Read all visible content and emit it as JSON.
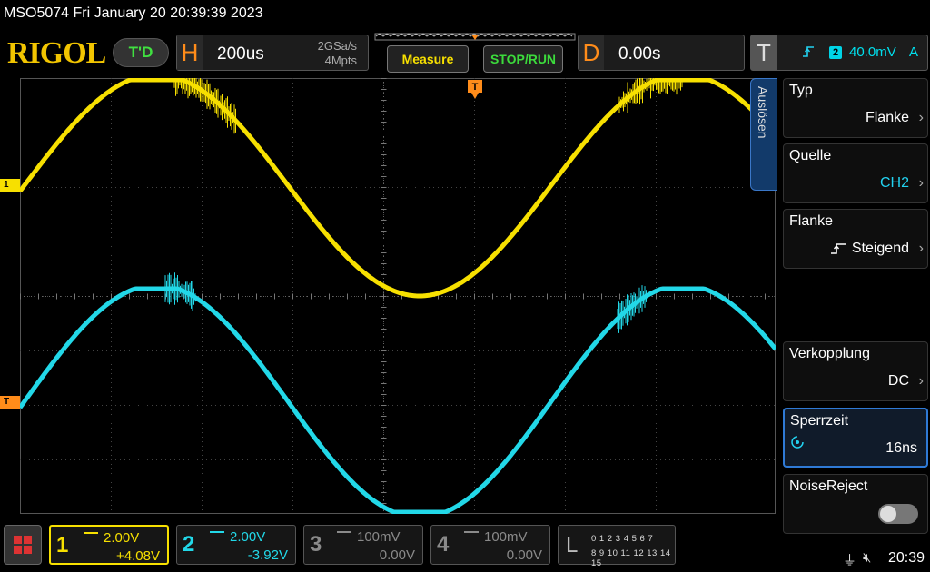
{
  "titlebar": {
    "text": "MSO5074  Fri January 20 20:39:39 2023"
  },
  "header": {
    "logo": "RIGOL",
    "td_label": "T'D",
    "horizontal": {
      "letter": "H",
      "timebase": "200us",
      "sample_rate": "2GSa/s",
      "memory_depth": "4Mpts"
    },
    "measure_label": "Measure",
    "stoprun_label": "STOP/RUN",
    "delay": {
      "letter": "D",
      "value": "0.00s"
    },
    "trigger": {
      "letter": "T",
      "source": "2",
      "level": "40.0mV",
      "mode": "A"
    }
  },
  "markers": {
    "ch1": "1",
    "ch2": "T",
    "trigger_top": "T"
  },
  "side_menu": {
    "tab_label": "Auslösen",
    "items": [
      {
        "title": "Typ",
        "value": "Flanke"
      },
      {
        "title": "Quelle",
        "value": "CH2"
      },
      {
        "title": "Flanke",
        "value": "Steigend"
      },
      {
        "title": "Verkopplung",
        "value": "DC"
      },
      {
        "title": "Sperrzeit",
        "value": "16ns"
      },
      {
        "title": "NoiseReject",
        "value": ""
      }
    ]
  },
  "channels": [
    {
      "num": "1",
      "scale": "2.00V",
      "offset": "+4.08V",
      "color": "#f7e000"
    },
    {
      "num": "2",
      "scale": "2.00V",
      "offset": "-3.92V",
      "color": "#22d8e8"
    },
    {
      "num": "3",
      "scale": "100mV",
      "offset": "0.00V",
      "color": "#8a8a8a"
    },
    {
      "num": "4",
      "scale": "100mV",
      "offset": "0.00V",
      "color": "#8a8a8a"
    }
  ],
  "logic": {
    "letter": "L",
    "row1": "0 1 2 3  4 5 6 7",
    "row2": "8 9 10 11 12 13 14 15"
  },
  "status": {
    "time": "20:39"
  },
  "colors": {
    "ch1": "#f7e000",
    "ch2": "#22d8e8",
    "trigger": "#ff8c1a",
    "accent": "#2f7ad6"
  }
}
